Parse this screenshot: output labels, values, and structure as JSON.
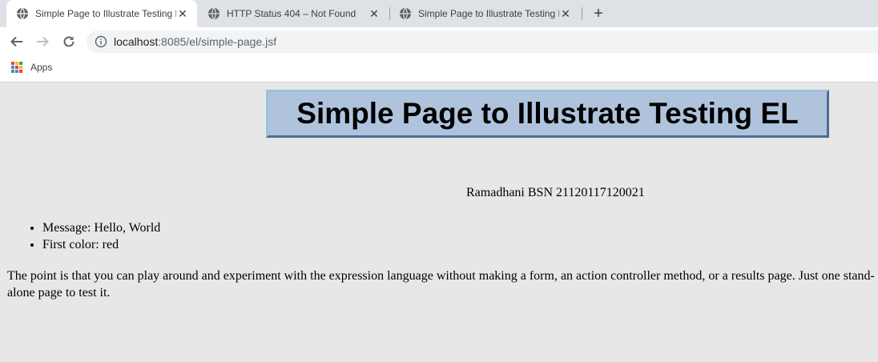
{
  "tabs": [
    {
      "title": "Simple Page to Illustrate Testing EL",
      "active": true
    },
    {
      "title": "HTTP Status 404 – Not Found",
      "active": false
    },
    {
      "title": "Simple Page to Illustrate Testing EL",
      "active": false
    }
  ],
  "toolbar": {
    "url_host": "localhost",
    "url_path": ":8085/el/simple-page.jsf"
  },
  "bookmarks": {
    "apps_label": "Apps"
  },
  "page": {
    "heading": "Simple Page to Illustrate Testing EL",
    "author": "Ramadhani BSN 21120117120021",
    "items": [
      "Message: Hello, World",
      "First color: red"
    ],
    "paragraph": "The point is that you can play around and experiment with the expression language without making a form, an action controller method, or a results page. Just one stand-alone page to test it."
  },
  "colors": {
    "tabbar_bg": "#dee1e6",
    "page_bg": "#e7e7e7",
    "heading_bg": "#afc4dc"
  }
}
